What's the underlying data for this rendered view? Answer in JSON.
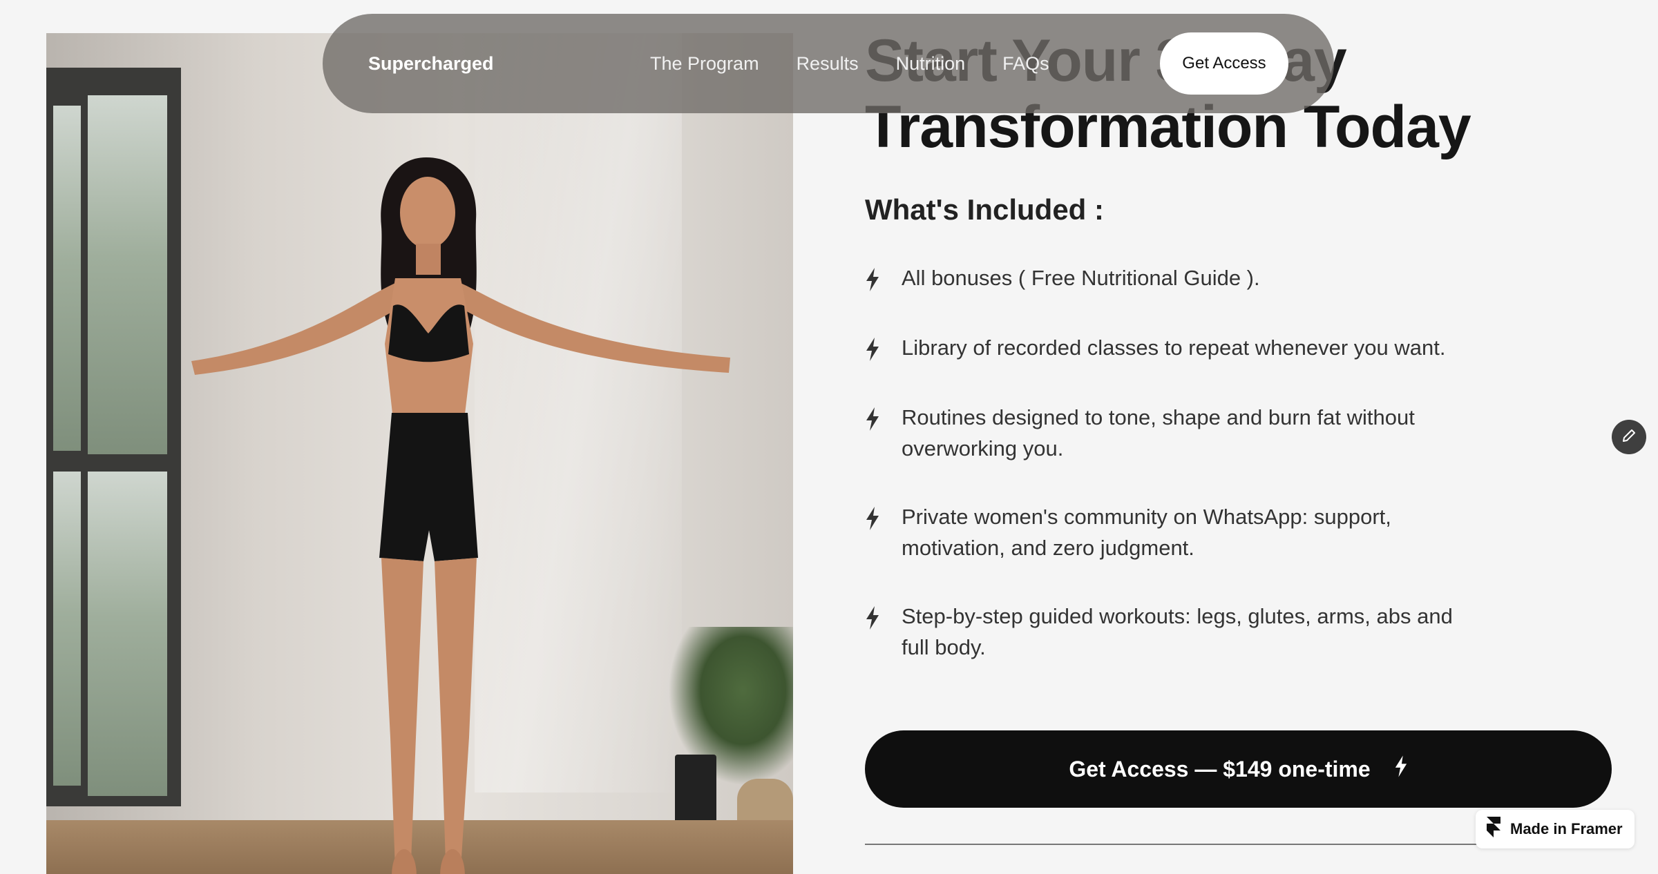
{
  "nav": {
    "brand": "Supercharged",
    "links": [
      "The Program",
      "Results",
      "Nutrition",
      "FAQs"
    ],
    "cta_label": "Get Access"
  },
  "hero": {
    "headline_line1": "Start Your 30-Day",
    "headline_line2": "Transformation Today",
    "image_alt": "Woman in black workout outfit levitating in a meditation pose in a bright room"
  },
  "included": {
    "title": "What's Included :",
    "items": [
      "All bonuses ( Free Nutritional Guide ).",
      "Library of recorded classes to repeat whenever you want.",
      "Routines designed to tone, shape and burn fat without overworking you.",
      "Private women's community on WhatsApp: support, motivation, and zero judgment.",
      "Step-by-step guided workouts: legs, glutes, arms, abs and full body."
    ],
    "item_icon": "bolt-icon"
  },
  "purchase": {
    "label": "Get Access — $149 one-time",
    "icon": "bolt-icon"
  },
  "badge": {
    "label": "Made in Framer",
    "icon": "framer-logo-icon"
  },
  "edit": {
    "icon": "pencil-icon"
  },
  "colors": {
    "background": "#f5f5f5",
    "button": "#0f0f0f",
    "nav": "#6e6a66"
  }
}
